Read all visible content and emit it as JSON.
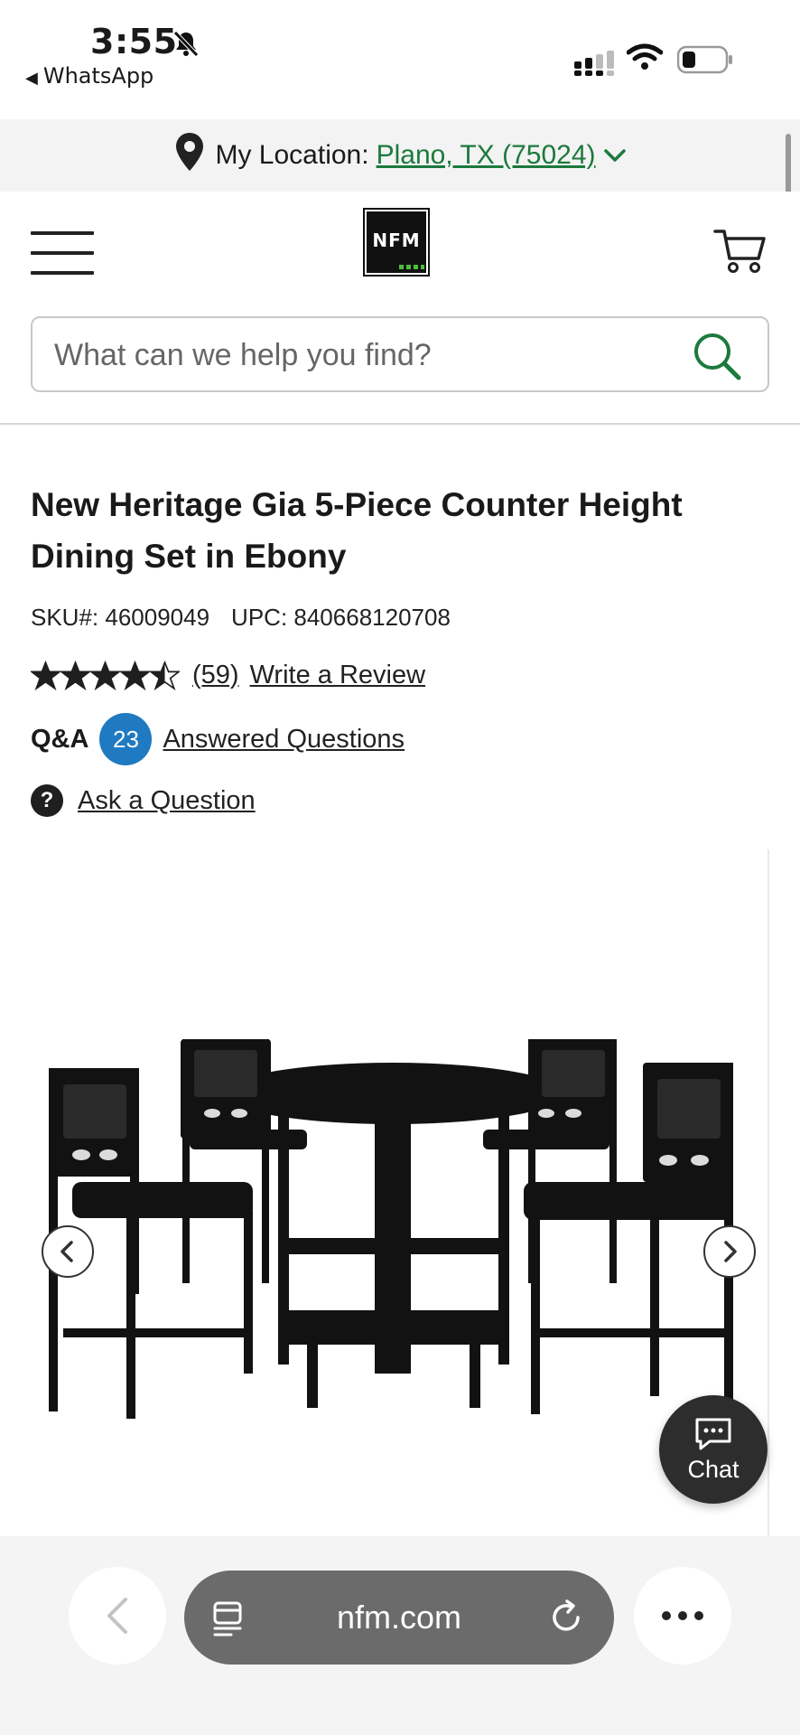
{
  "status_bar": {
    "time": "3:55",
    "back_app": "WhatsApp"
  },
  "location": {
    "label": "My Location:",
    "value": "Plano, TX (75024)"
  },
  "header": {
    "logo_text": "NFM"
  },
  "search": {
    "placeholder": "What can we help you find?"
  },
  "product": {
    "title": "New Heritage Gia 5-Piece Counter Height Dining Set in Ebony",
    "sku": "SKU#: 46009049",
    "upc": "UPC: 840668120708",
    "rating": 4.5,
    "review_count": "(59)",
    "write_review": "Write a Review",
    "qa_label": "Q&A",
    "qa_count": "23",
    "qa_link": "Answered Questions",
    "ask_question": "Ask a Question"
  },
  "chat": {
    "label": "Chat"
  },
  "browser": {
    "url": "nfm.com"
  },
  "colors": {
    "accent_green": "#1b7a3c",
    "badge_blue": "#1f7ac1",
    "chat_bg": "#2d2d2d",
    "url_pill": "#6b6b6b"
  },
  "icons": [
    "bell-slash-icon",
    "signal-icon",
    "wifi-icon",
    "battery-icon",
    "location-pin-icon",
    "chevron-down-icon",
    "hamburger-menu-icon",
    "cart-icon",
    "search-icon",
    "star-icon",
    "question-icon",
    "chevron-left-icon",
    "chevron-right-icon",
    "chat-icon",
    "tabs-icon",
    "reload-icon",
    "more-icon"
  ]
}
